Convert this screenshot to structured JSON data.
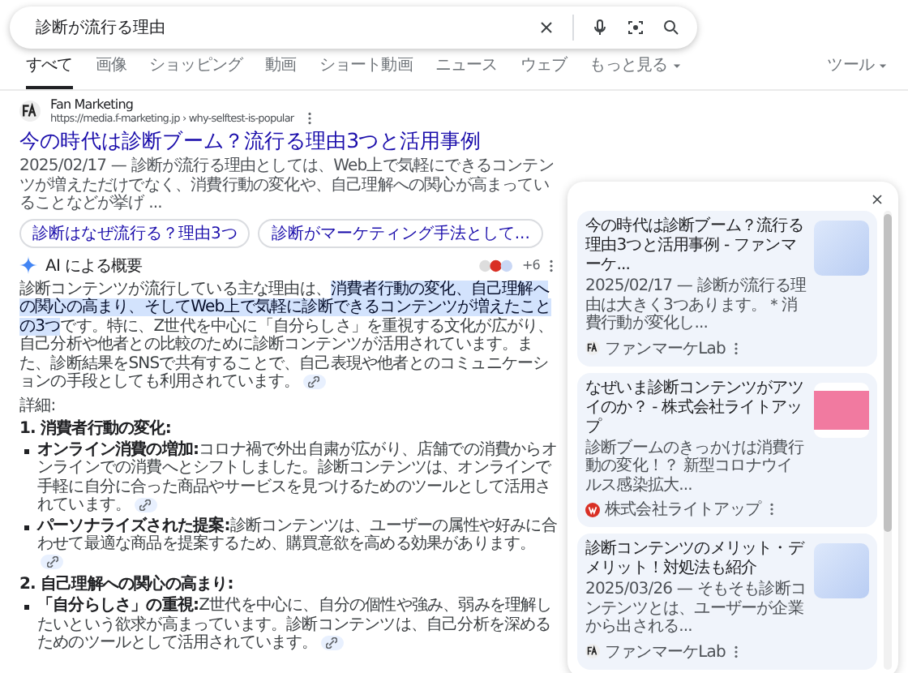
{
  "search": {
    "value": "診断が流行る理由"
  },
  "tabs": [
    {
      "label": "すべて",
      "selected": true,
      "kind": "plain"
    },
    {
      "label": "画像",
      "selected": false,
      "kind": "plain"
    },
    {
      "label": "ショッピング",
      "selected": false,
      "kind": "plain"
    },
    {
      "label": "動画",
      "selected": false,
      "kind": "plain"
    },
    {
      "label": "ショート動画",
      "selected": false,
      "kind": "plain"
    },
    {
      "label": "ニュース",
      "selected": false,
      "kind": "plain"
    },
    {
      "label": "ウェブ",
      "selected": false,
      "kind": "plain"
    },
    {
      "label": "もっと見る",
      "selected": false,
      "kind": "menu"
    }
  ],
  "tools": {
    "label": "ツール"
  },
  "result": {
    "site_name": "Fan Marketing",
    "url": "https://media.f-marketing.jp › why-selftest-is-popular",
    "title": "今の時代は診断ブーム？流行る理由3つと活用事例",
    "snippet": "2025/02/17 — 診断が流行る理由としては、Web上で気軽にできるコンテンツが増えただけでなく、消費行動の変化や、自己理解への関心が高まっていることなどが挙げ ...",
    "chips": [
      "診断はなぜ流行る？理由3つ",
      "診断がマーケティング手法として..."
    ]
  },
  "ai_overview": {
    "label": "AI による概要",
    "source_count": "+6",
    "summary": [
      {
        "text": "診断コンテンツが流行している主な理由は、",
        "highlighted": false
      },
      {
        "text": "消費者行動の変化、自己理解への関心の高まり、そしてWeb上で気軽に診断できるコンテンツが増えたことの3つ",
        "highlighted": true
      },
      {
        "text": "です。特に、Z世代を中心に「自分らしさ」を重視する文化が広がり、自己分析や他者との比較のために診断コンテンツが活用されています。また、診断結果をSNSで共有することで、自己表現や他者とのコミュニケーションの手段としても利用されています。",
        "highlighted": false
      }
    ],
    "details_label": "詳細:",
    "sections": [
      {
        "heading": "1. 消費者行動の変化:",
        "items": [
          {
            "text": "**オンライン消費の増加:**コロナ禍で外出自粛が広がり、店舗での消費からオンラインでの消費へとシフトしました。診断コンテンツは、オンラインで手軽に自分に合った商品やサービスを見つけるためのツールとして活用されています。"
          },
          {
            "text": "**パーソナライズされた提案:**診断コンテンツは、ユーザーの属性や好みに合わせて最適な商品を提案するため、購買意欲を高める効果があります。"
          }
        ]
      },
      {
        "heading": "2. 自己理解への関心の高まり:",
        "items": [
          {
            "text": "**「自分らしさ」の重視:**Z世代を中心に、自分の個性や強み、弱みを理解したいという欲求が高まっています。診断コンテンツは、自己分析を深めるためのツールとして活用されています。"
          }
        ]
      }
    ]
  },
  "panel": {
    "cards": [
      {
        "title": "今の時代は診断ブーム？流行る理由3つと活用事例 - ファンマーケ...",
        "snippet": "2025/02/17 — 診断が流行る理由は大きく3つあります。＊消費行動が変化し...",
        "source": "ファンマーケLab",
        "kind": "fan"
      },
      {
        "title": "なぜいま診断コンテンツがアツイのか？ - 株式会社ライトアップ",
        "snippet": "診断ブームのきっかけは消費行動の変化！？ 新型コロナウイルス感染拡大...",
        "source": "株式会社ライトアップ",
        "kind": "lightup"
      },
      {
        "title": "診断コンテンツのメリット・デメリット！対処法も紹介",
        "snippet": "2025/03/26 — そもそも診断コンテンツとは、ユーザーが企業から出される...",
        "source": "ファンマーケLab",
        "kind": "fan"
      }
    ]
  }
}
